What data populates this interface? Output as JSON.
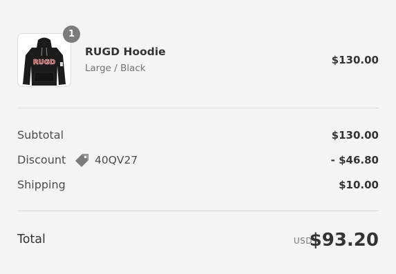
{
  "product": {
    "quantity": "1",
    "name": "RUGD Hoodie",
    "variant": "Large / Black",
    "price": "$130.00",
    "image_icon": "hoodie-image",
    "print_text": "RUGD"
  },
  "summary": {
    "subtotal_label": "Subtotal",
    "subtotal_value": "$130.00",
    "discount_label": "Discount",
    "discount_code": "40QV27",
    "discount_icon": "tag-icon",
    "discount_value": "- $46.80",
    "shipping_label": "Shipping",
    "shipping_value": "$10.00"
  },
  "total": {
    "label": "Total",
    "currency": "USD",
    "value": "$93.20"
  },
  "colors": {
    "background": "#f4f4f4",
    "badge": "#7b7b7b",
    "text_primary": "#333333",
    "text_secondary": "#727272",
    "divider": "#d9d9d9",
    "hoodie": "#1b1b1b",
    "print": "#d8232a"
  }
}
